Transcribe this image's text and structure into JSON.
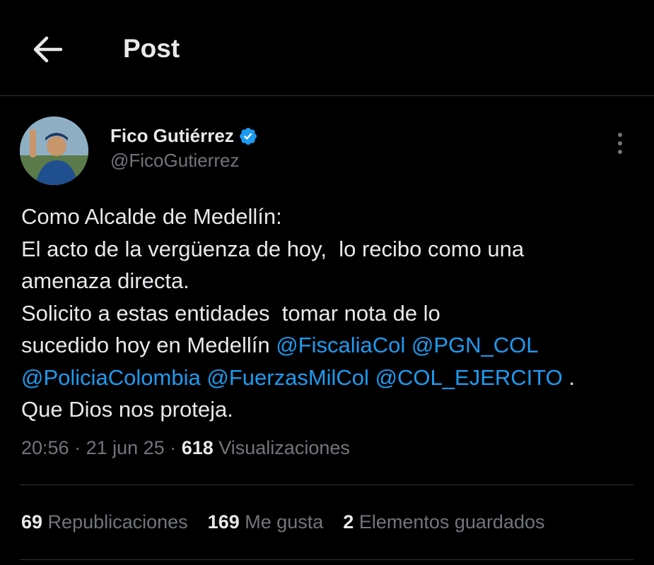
{
  "header": {
    "title": "Post"
  },
  "author": {
    "name": "Fico Gutiérrez",
    "handle": "@FicoGutierrez"
  },
  "tweet": {
    "lines": [
      [
        {
          "t": "Como Alcalde de Medellín:"
        }
      ],
      [
        {
          "t": "El acto de la vergüenza de hoy,  lo recibo como una"
        }
      ],
      [
        {
          "t": "amenaza directa."
        }
      ],
      [
        {
          "t": "Solicito a estas entidades  tomar nota de lo"
        }
      ],
      [
        {
          "t": "sucedido hoy en Medellín "
        },
        {
          "m": "@FiscaliaCol"
        },
        {
          "t": " "
        },
        {
          "m": "@PGN_COL"
        }
      ],
      [
        {
          "m": "@PoliciaColombia"
        },
        {
          "t": " "
        },
        {
          "m": "@FuerzasMilCol"
        },
        {
          "t": " "
        },
        {
          "m": "@COL_EJERCITO"
        },
        {
          "t": " ."
        }
      ],
      [
        {
          "t": "Que Dios nos proteja."
        }
      ]
    ]
  },
  "meta": {
    "time": "20:56",
    "sep1": " · ",
    "date": "21 jun 25",
    "sep2": " · ",
    "views": "618",
    "views_label": " Visualizaciones"
  },
  "stats": [
    {
      "value": "69",
      "label": " Republicaciones"
    },
    {
      "value": "169",
      "label": " Me gusta"
    },
    {
      "value": "2",
      "label": " Elementos guardados"
    }
  ],
  "colors": {
    "accent": "#1d9bf0",
    "text": "#e7e9ea",
    "muted": "#71767b",
    "border": "#2f3336",
    "bg": "#000000"
  },
  "icons": {
    "back": "arrow-left-icon",
    "verified": "verified-badge-icon",
    "more": "more-vertical-icon"
  }
}
